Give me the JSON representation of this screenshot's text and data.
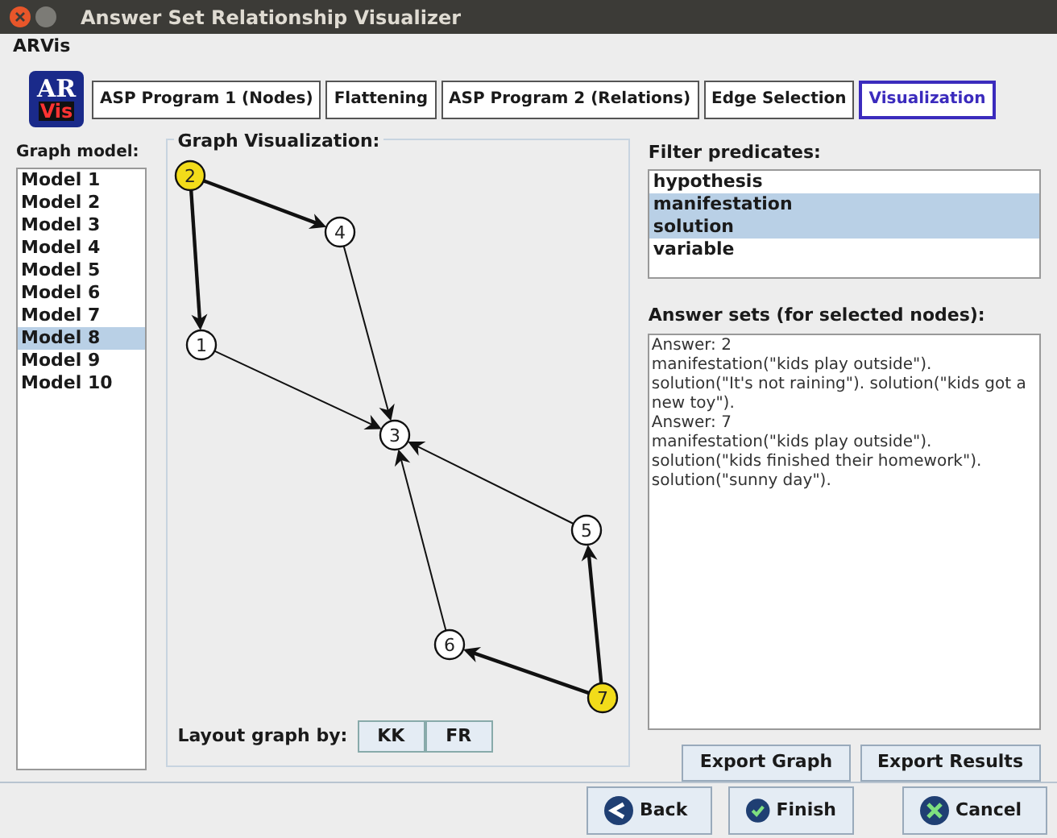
{
  "window": {
    "title": "Answer Set Relationship Visualizer"
  },
  "menu": [
    "ARVis"
  ],
  "logo": {
    "top": "AR",
    "bottom": "Vis"
  },
  "tabs": [
    {
      "label": "ASP Program 1 (Nodes)",
      "selected": false
    },
    {
      "label": "Flattening",
      "selected": false
    },
    {
      "label": "ASP Program 2 (Relations)",
      "selected": false
    },
    {
      "label": "Edge Selection",
      "selected": false
    },
    {
      "label": "Visualization",
      "selected": true
    }
  ],
  "graph_model": {
    "label": "Graph model:",
    "items": [
      {
        "label": "Model 1",
        "selected": false
      },
      {
        "label": "Model 2",
        "selected": false
      },
      {
        "label": "Model 3",
        "selected": false
      },
      {
        "label": "Model 4",
        "selected": false
      },
      {
        "label": "Model 5",
        "selected": false
      },
      {
        "label": "Model 6",
        "selected": false
      },
      {
        "label": "Model 7",
        "selected": false
      },
      {
        "label": "Model 8",
        "selected": true
      },
      {
        "label": "Model 9",
        "selected": false
      },
      {
        "label": "Model 10",
        "selected": false
      }
    ]
  },
  "graph": {
    "label": "Graph Visualization:",
    "nodes": [
      {
        "label": "2",
        "selected": true
      },
      {
        "label": "4",
        "selected": false
      },
      {
        "label": "1",
        "selected": false
      },
      {
        "label": "3",
        "selected": false
      },
      {
        "label": "5",
        "selected": false
      },
      {
        "label": "6",
        "selected": false
      },
      {
        "label": "7",
        "selected": true
      }
    ],
    "layout_label": "Layout graph by:",
    "layout_buttons": [
      "KK",
      "FR"
    ]
  },
  "filter": {
    "label": "Filter predicates:",
    "items": [
      {
        "label": "hypothesis",
        "selected": false
      },
      {
        "label": "manifestation",
        "selected": true
      },
      {
        "label": "solution",
        "selected": true
      },
      {
        "label": "variable",
        "selected": false
      }
    ]
  },
  "answer_sets": {
    "label": "Answer sets (for selected nodes):",
    "lines": [
      "Answer: 2",
      "manifestation(\"kids play outside\").",
      "solution(\"It's not raining\"). solution(\"kids got a new toy\").",
      "Answer: 7",
      "manifestation(\"kids play outside\").",
      "solution(\"kids finished their homework\").",
      "solution(\"sunny day\")."
    ]
  },
  "export_buttons": [
    "Export Graph",
    "Export Results"
  ],
  "footer_buttons": [
    {
      "label": "Back",
      "kind": "back"
    },
    {
      "label": "Finish",
      "kind": "finish"
    },
    {
      "label": "Cancel",
      "kind": "cancel"
    }
  ]
}
